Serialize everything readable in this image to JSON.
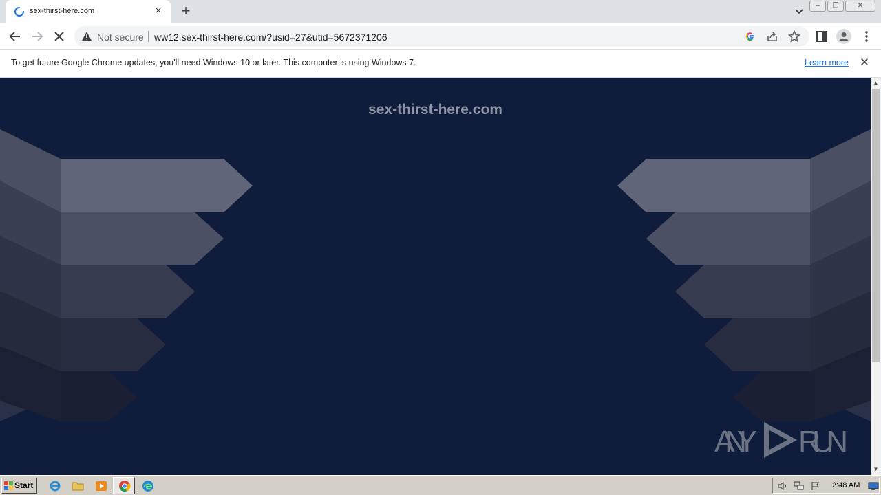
{
  "browser": {
    "tab": {
      "title": "sex-thirst-here.com",
      "close_glyph": "×"
    },
    "new_tab_glyph": "+",
    "window_buttons": [
      "–",
      "❐",
      "✕"
    ],
    "address_bar": {
      "security_label": "Not secure",
      "url": "ww12.sex-thirst-here.com/?usid=27&utid=5672371206"
    },
    "infobar": {
      "message": "To get future Google Chrome updates, you'll need Windows 10 or later. This computer is using Windows 7.",
      "link": "Learn more",
      "close_glyph": "✕"
    }
  },
  "page": {
    "site_title": "sex-thirst-here.com",
    "watermark": "ANY RUN",
    "background_color": "#0f1c3b"
  },
  "taskbar": {
    "start_label": "Start",
    "clock": "2:48 AM"
  },
  "icons": [
    "loading-spinner-icon",
    "back-icon",
    "forward-icon",
    "stop-icon",
    "warning-icon",
    "google-icon",
    "share-icon",
    "star-icon",
    "sidepanel-icon",
    "profile-icon",
    "menu-icon",
    "ie-icon",
    "explorer-icon",
    "media-player-icon",
    "chrome-icon",
    "edge-icon",
    "volume-icon",
    "network-icon",
    "flag-icon",
    "monitor-icon"
  ]
}
